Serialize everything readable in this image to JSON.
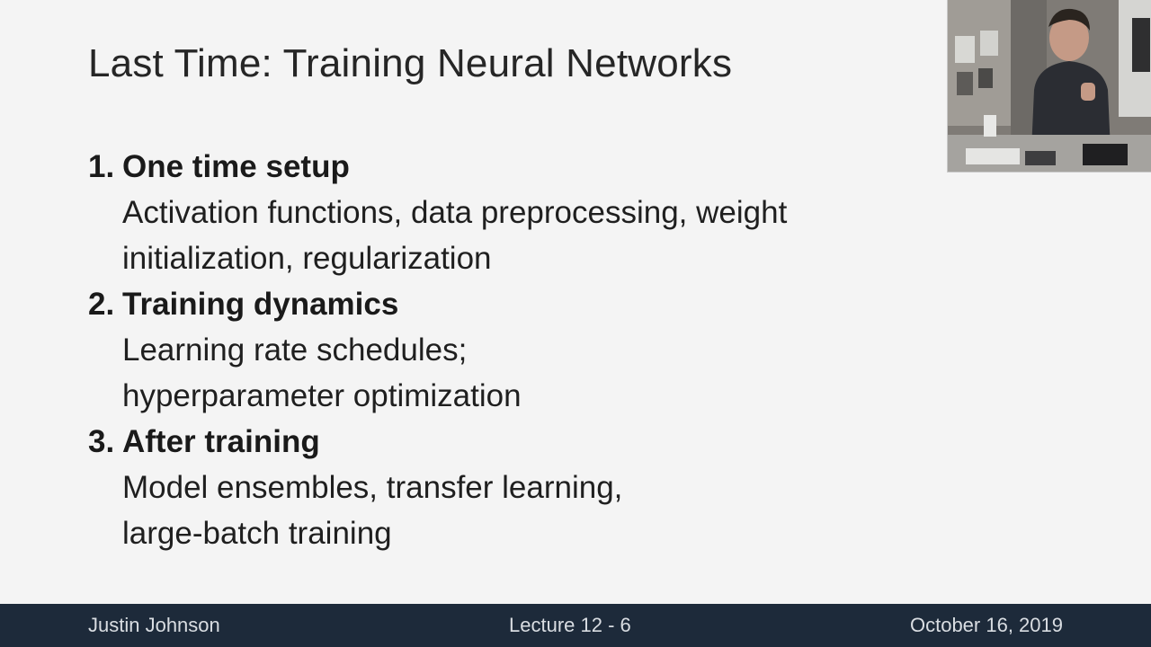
{
  "slide": {
    "title": "Last Time: Training Neural Networks",
    "items": [
      {
        "number": "1.",
        "heading": "One time setup",
        "details": [
          "Activation functions, data preprocessing, weight",
          "initialization, regularization"
        ]
      },
      {
        "number": "2.",
        "heading": "Training dynamics",
        "details": [
          "Learning rate schedules;",
          "hyperparameter optimization"
        ]
      },
      {
        "number": "3.",
        "heading": "After training",
        "details": [
          "Model ensembles, transfer learning,",
          "large-batch training"
        ]
      }
    ]
  },
  "footer": {
    "author": "Justin Johnson",
    "lecture": "Lecture 12 - 6",
    "date": "October 16, 2019"
  },
  "colors": {
    "footer_bg": "#1d2a3a",
    "slide_bg": "#f4f4f4"
  }
}
